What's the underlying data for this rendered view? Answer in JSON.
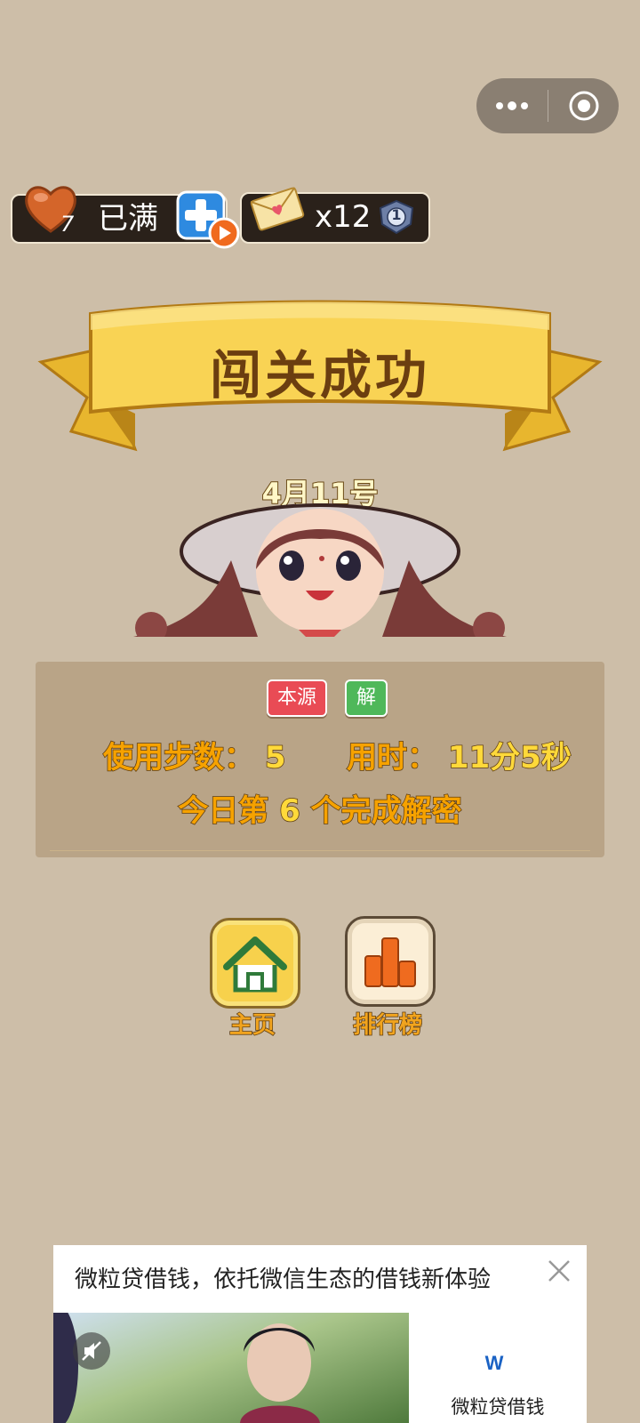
{
  "status": {
    "lives_count": "7",
    "lives_status": "已满",
    "mail_count": "x12",
    "level_badge": "1"
  },
  "banner": {
    "title": "闯关成功"
  },
  "date_label": "4月11号",
  "result": {
    "tag_source": "本源",
    "tag_solution": "解",
    "steps_label": "使用步数：",
    "steps_value": "5",
    "time_label": "用时：",
    "time_value": "11分5秒",
    "today_prefix": "今日第",
    "today_value": "6",
    "today_suffix": "个完成解密"
  },
  "nav": {
    "home_label": "主页",
    "rank_label": "排行榜"
  },
  "ad": {
    "title": "微粒贷借钱，依托微信生态的借钱新体验",
    "brand_name": "微粒贷借钱",
    "logo_text": "W"
  },
  "colors": {
    "background": "#cdbea8",
    "banner_gold": "#f7d14c",
    "stat_orange": "#f6a200",
    "stat_yellow": "#ffd93a",
    "tag_red": "#e94b55",
    "tag_green": "#4fb85a"
  }
}
